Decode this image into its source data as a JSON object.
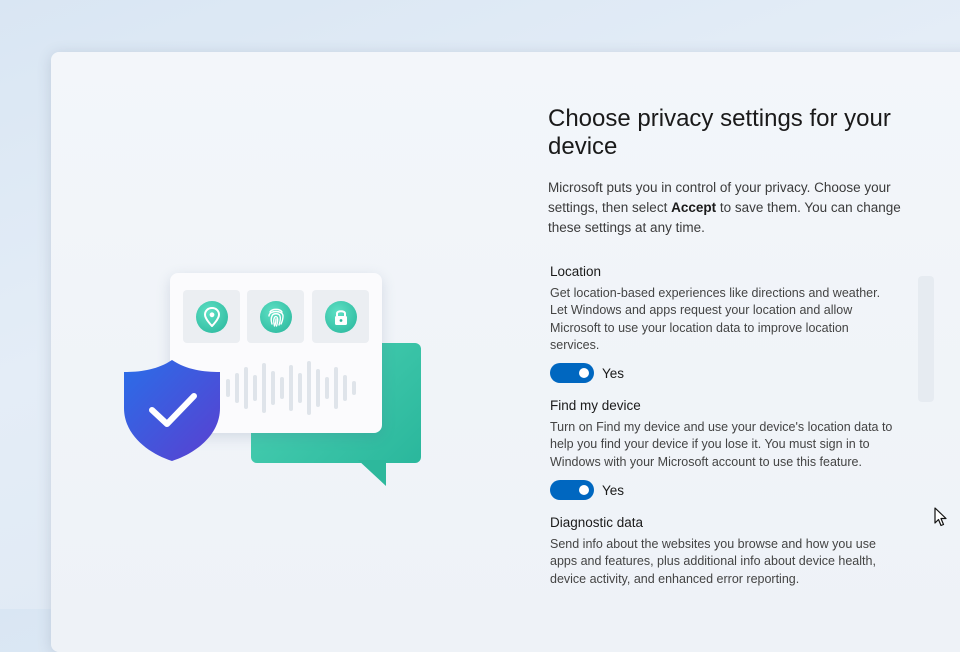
{
  "page": {
    "title": "Choose privacy settings for your device",
    "intro_before": "Microsoft puts you in control of your privacy. Choose your settings, then select ",
    "intro_bold": "Accept",
    "intro_after": " to save them. You can change these settings at any time."
  },
  "settings": [
    {
      "title": "Location",
      "description": "Get location-based experiences like directions and weather. Let Windows and apps request your location and allow Microsoft to use your location data to improve location services.",
      "toggle_label": "Yes",
      "toggle_on": true
    },
    {
      "title": "Find my device",
      "description": "Turn on Find my device and use your device's location data to help you find your device if you lose it. You must sign in to Windows with your Microsoft account to use this feature.",
      "toggle_label": "Yes",
      "toggle_on": true
    },
    {
      "title": "Diagnostic data",
      "description": "Send info about the websites you browse and how you use apps and features, plus additional info about device health, device activity, and enhanced error reporting."
    }
  ],
  "illustration": {
    "icons": [
      "location-pin-icon",
      "fingerprint-icon",
      "lock-icon",
      "shield-check-icon"
    ]
  },
  "colors": {
    "accent": "#0067c0",
    "teal": "#2ab79c",
    "shield": "#3b4fd6"
  }
}
